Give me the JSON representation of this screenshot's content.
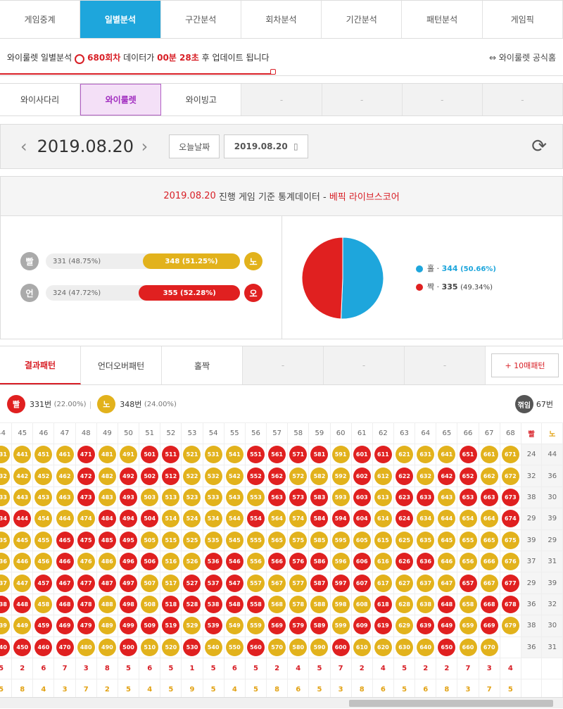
{
  "nav": [
    "게임중계",
    "일별분석",
    "구간분석",
    "회차분석",
    "기간분석",
    "패턴분석",
    "게임픽"
  ],
  "nav_active": 1,
  "info": {
    "prefix": "와이룰렛 일별분석",
    "round": "680회차",
    "mid": "데이터가",
    "time": "00분 28초",
    "suffix": "후 업데이트 됩니다",
    "right": "와이룰렛 공식홈",
    "progress_pct": 48.5
  },
  "game_tabs": [
    "와이사다리",
    "와이룰렛",
    "와이빙고",
    "-",
    "-",
    "-",
    "-"
  ],
  "game_tabs_active": 1,
  "date": {
    "current": "2019.08.20",
    "today_btn": "오늘날짜",
    "picker": "2019.08.20"
  },
  "stats": {
    "head_date": "2019.08.20",
    "head_mid": "진행 게임 기준 통계데이터 -",
    "head_brand": "베픽 라이브스코어",
    "rows": [
      {
        "left_label": "빨",
        "left_text": "331 (48.75%)",
        "right_text": "348 (51.25%)",
        "right_label": "노",
        "fill_pct": 51.25
      },
      {
        "left_label": "언",
        "left_text": "324 (47.72%)",
        "right_text": "355 (52.28%)",
        "right_label": "오",
        "fill_pct": 52.28
      }
    ],
    "pie": {
      "odd": {
        "label": "홀",
        "value": "344",
        "pct": "(50.66%)",
        "fraction": 0.5066
      },
      "even": {
        "label": "짝",
        "value": "335",
        "pct": "(49.34%)",
        "fraction": 0.4934
      }
    }
  },
  "pattern_tabs": [
    "결과패턴",
    "언더오버패턴",
    "홀짝",
    "-",
    "-",
    "-"
  ],
  "pattern_plus": "+ 10매패턴",
  "summary": {
    "red_label": "빨",
    "red_count": "331번",
    "red_pct": "(22.00%)",
    "yel_label": "노",
    "yel_count": "348번",
    "yel_pct": "(24.00%)",
    "turn_label": "꺾임",
    "turn_count": "67번"
  },
  "grid": {
    "columns": [
      "44",
      "45",
      "46",
      "47",
      "48",
      "49",
      "50",
      "51",
      "52",
      "53",
      "54",
      "55",
      "56",
      "57",
      "58",
      "59",
      "60",
      "61",
      "62",
      "63",
      "64",
      "65",
      "66",
      "67",
      "68"
    ],
    "count_headers": [
      "빨",
      "노"
    ],
    "colors": [
      "YYYRYYRRYYYRRRRYRRYYYRYY",
      "YYYRYRRRYYYRRYYYRYRYRRYY",
      "YYYRYRYYYYYYRRRYRYRRYRRR",
      "RYYYRRRYYYYRYYRRRYRYYYYR",
      "YYRRRRYYYYYYYYYYYYYYYYYY",
      "YYRYYRRYYRRYRRRYRYRRYYYY",
      "YRRRRRYYRRRYYYRRRYYYYRYR",
      "RYRRYRYRRRRRYYYYYRYYRYRR",
      "YRRRYRRRYRYYRRRYRRYRRYRY",
      "RRRYYRYYRYYRYYYRYYYYRYY"
    ],
    "counts": [
      [
        "24",
        "44"
      ],
      [
        "32",
        "36"
      ],
      [
        "38",
        "30"
      ],
      [
        "29",
        "39"
      ],
      [
        "39",
        "29"
      ],
      [
        "37",
        "31"
      ],
      [
        "29",
        "39"
      ],
      [
        "36",
        "32"
      ],
      [
        "38",
        "30"
      ],
      [
        "36",
        "31"
      ]
    ],
    "footer_red": [
      "5",
      "2",
      "6",
      "7",
      "3",
      "8",
      "5",
      "6",
      "5",
      "1",
      "5",
      "6",
      "5",
      "2",
      "4",
      "5",
      "7",
      "2",
      "4",
      "5",
      "2",
      "2",
      "7",
      "3",
      "4"
    ],
    "footer_yel": [
      "5",
      "8",
      "4",
      "3",
      "7",
      "2",
      "5",
      "4",
      "5",
      "9",
      "5",
      "4",
      "5",
      "8",
      "6",
      "5",
      "3",
      "8",
      "6",
      "5",
      "6",
      "8",
      "3",
      "7",
      "5"
    ]
  }
}
